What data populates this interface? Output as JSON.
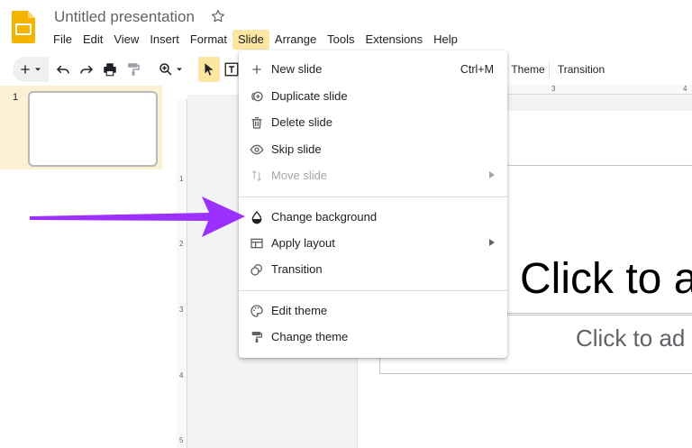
{
  "app": {
    "title": "Untitled presentation",
    "logo_icon": "google-slides-logo",
    "accent_color": "#f4b400"
  },
  "menubar": {
    "items": [
      {
        "label": "File",
        "active": false
      },
      {
        "label": "Edit",
        "active": false
      },
      {
        "label": "View",
        "active": false
      },
      {
        "label": "Insert",
        "active": false
      },
      {
        "label": "Format",
        "active": false
      },
      {
        "label": "Slide",
        "active": true
      },
      {
        "label": "Arrange",
        "active": false
      },
      {
        "label": "Tools",
        "active": false
      },
      {
        "label": "Extensions",
        "active": false
      },
      {
        "label": "Help",
        "active": false
      }
    ]
  },
  "toolbar": {
    "theme_label": "Theme",
    "transition_label": "Transition"
  },
  "filmstrip": {
    "slide_number": "1"
  },
  "rulers": {
    "top_numbers": [
      "3",
      "4"
    ],
    "left_numbers": [
      "1",
      "2",
      "3",
      "4",
      "5"
    ]
  },
  "slide": {
    "title_placeholder": "Click to a",
    "subtitle_placeholder": "Click to ad"
  },
  "slide_menu": {
    "items": [
      {
        "label": "New slide",
        "icon": "plus-icon",
        "shortcut": "Ctrl+M"
      },
      {
        "label": "Duplicate slide",
        "icon": "duplicate-icon"
      },
      {
        "label": "Delete slide",
        "icon": "trash-icon"
      },
      {
        "label": "Skip slide",
        "icon": "eye-icon"
      },
      {
        "label": "Move slide",
        "icon": "move-icon",
        "disabled": true,
        "submenu": true
      },
      {
        "label": "Change background",
        "icon": "background-drop-icon"
      },
      {
        "label": "Apply layout",
        "icon": "layout-icon",
        "submenu": true
      },
      {
        "label": "Transition",
        "icon": "transition-icon"
      },
      {
        "label": "Edit theme",
        "icon": "palette-icon"
      },
      {
        "label": "Change theme",
        "icon": "paint-roller-icon"
      }
    ]
  },
  "annotation": {
    "arrow_color": "#9b30ff"
  }
}
